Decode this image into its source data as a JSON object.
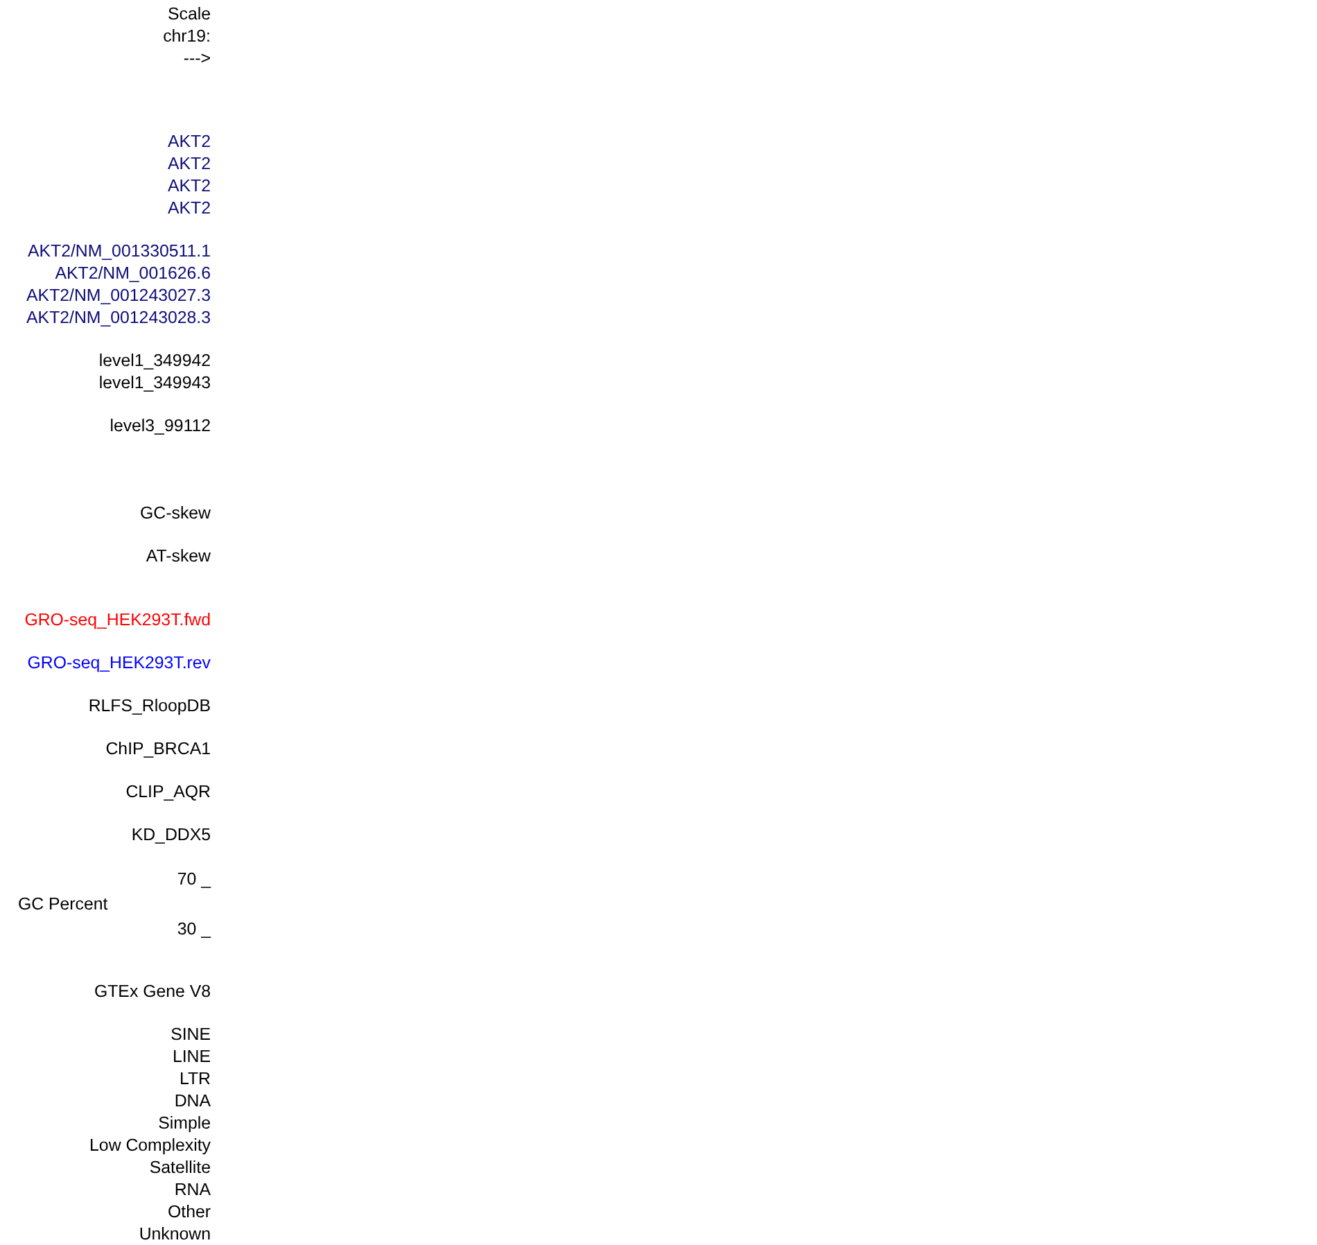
{
  "tracks": [
    {
      "kind": "ruler",
      "color": "#000000",
      "labels": [
        "Scale",
        "chr19:",
        "--->"
      ]
    },
    {
      "kind": "genes",
      "color": "#0c0c78",
      "labels": [
        "AKT2",
        "AKT2",
        "AKT2",
        "AKT2"
      ]
    },
    {
      "kind": "genes",
      "color": "#0c0c78",
      "labels": [
        "AKT2/NM_001330511.1",
        "AKT2/NM_001626.6",
        "AKT2/NM_001243027.3",
        "AKT2/NM_001243028.3"
      ]
    },
    {
      "kind": "bed",
      "color": "#000000",
      "labels": [
        "level1_349942",
        "level1_349943"
      ]
    },
    {
      "kind": "bed",
      "color": "#000000",
      "labels": [
        "level3_99112"
      ]
    },
    {
      "kind": "skew",
      "color": "#000000",
      "labels": [
        "GC-skew"
      ]
    },
    {
      "kind": "skew",
      "color": "#000000",
      "labels": [
        "AT-skew"
      ]
    },
    {
      "kind": "signal",
      "color": "#ff0000",
      "labels": [
        "GRO-seq_HEK293T.fwd"
      ]
    },
    {
      "kind": "signal",
      "color": "#0000ff",
      "labels": [
        "GRO-seq_HEK293T.rev"
      ]
    },
    {
      "kind": "bed",
      "color": "#000000",
      "labels": [
        "RLFS_RloopDB"
      ]
    },
    {
      "kind": "bed",
      "color": "#000000",
      "labels": [
        "ChIP_BRCA1"
      ]
    },
    {
      "kind": "bed",
      "color": "#000000",
      "labels": [
        "CLIP_AQR"
      ]
    },
    {
      "kind": "bed",
      "color": "#000000",
      "labels": [
        "KD_DDX5"
      ]
    },
    {
      "kind": "graph",
      "color": "#000000",
      "max": "70 _",
      "name": "GC Percent",
      "min": "30 _"
    },
    {
      "kind": "expression",
      "color": "#000000",
      "labels": [
        "GTEx Gene V8"
      ]
    },
    {
      "kind": "repeats",
      "color": "#000000",
      "labels": [
        "SINE",
        "LINE",
        "LTR",
        "DNA",
        "Simple",
        "Low Complexity",
        "Satellite",
        "RNA",
        "Other",
        "Unknown"
      ]
    }
  ]
}
